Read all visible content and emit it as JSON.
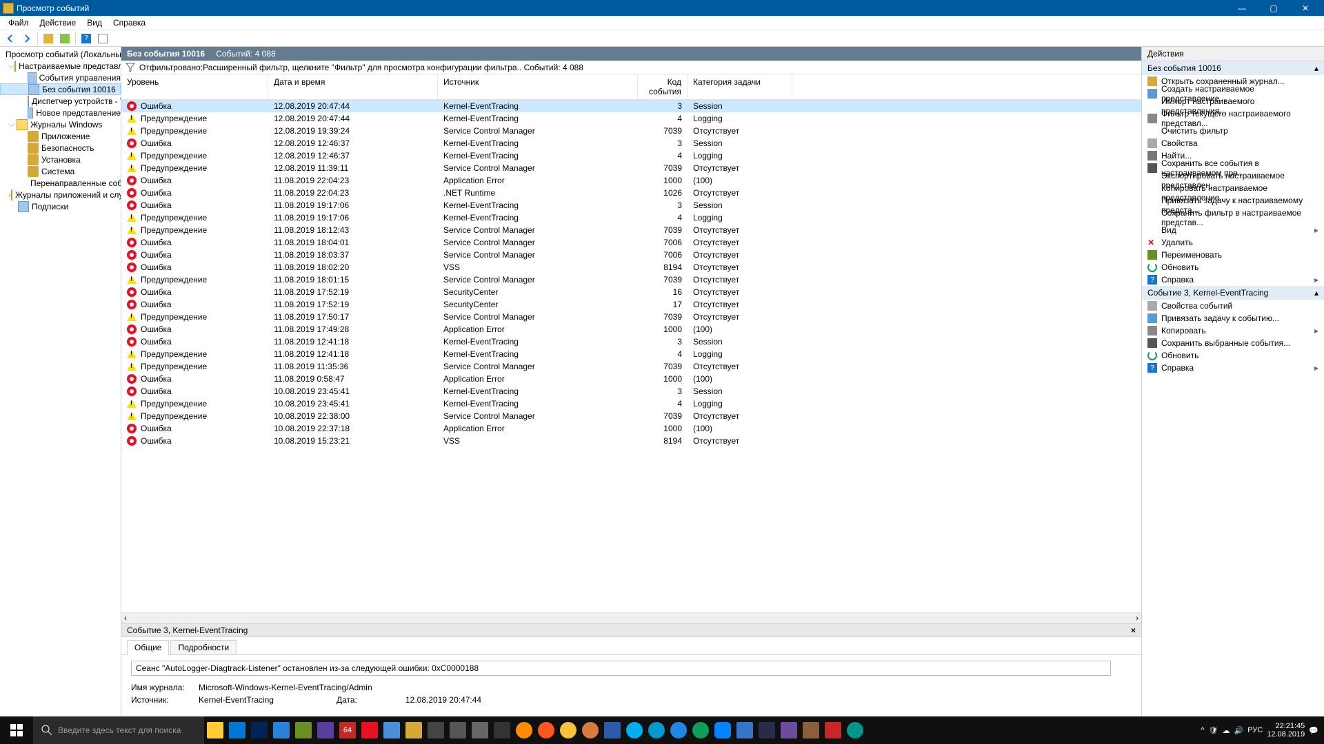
{
  "window": {
    "title": "Просмотр событий"
  },
  "menubar": {
    "items": [
      "Файл",
      "Действие",
      "Вид",
      "Справка"
    ]
  },
  "tree": {
    "root": "Просмотр событий (Локальный",
    "custom_views": {
      "label": "Настраиваемые представле",
      "children": [
        {
          "label": "События управления"
        },
        {
          "label": "Без события 10016",
          "selected": true
        },
        {
          "label": "Диспетчер устройств - V"
        },
        {
          "label": "Новое представление"
        }
      ]
    },
    "win_logs": {
      "label": "Журналы Windows",
      "children": [
        {
          "label": "Приложение"
        },
        {
          "label": "Безопасность"
        },
        {
          "label": "Установка"
        },
        {
          "label": "Система"
        },
        {
          "label": "Перенаправленные соб"
        }
      ]
    },
    "apps_logs": "Журналы приложений и слу",
    "subs": "Подписки"
  },
  "center": {
    "title": "Без события 10016",
    "count_label": "Событий: 4 088",
    "filter_note": "Отфильтровано:Расширенный фильтр, щелкните \"Фильтр\" для просмотра конфигурации фильтра.. Событий: 4 088"
  },
  "columns": {
    "level": "Уровень",
    "date": "Дата и время",
    "src": "Источник",
    "code": "Код события",
    "cat": "Категория задачи"
  },
  "events": [
    {
      "lvl": "err",
      "level": "Ошибка",
      "date": "12.08.2019 20:47:44",
      "src": "Kernel-EventTracing",
      "code": "3",
      "cat": "Session",
      "sel": true
    },
    {
      "lvl": "warn",
      "level": "Предупреждение",
      "date": "12.08.2019 20:47:44",
      "src": "Kernel-EventTracing",
      "code": "4",
      "cat": "Logging"
    },
    {
      "lvl": "warn",
      "level": "Предупреждение",
      "date": "12.08.2019 19:39:24",
      "src": "Service Control Manager",
      "code": "7039",
      "cat": "Отсутствует"
    },
    {
      "lvl": "err",
      "level": "Ошибка",
      "date": "12.08.2019 12:46:37",
      "src": "Kernel-EventTracing",
      "code": "3",
      "cat": "Session"
    },
    {
      "lvl": "warn",
      "level": "Предупреждение",
      "date": "12.08.2019 12:46:37",
      "src": "Kernel-EventTracing",
      "code": "4",
      "cat": "Logging"
    },
    {
      "lvl": "warn",
      "level": "Предупреждение",
      "date": "12.08.2019 11:39:11",
      "src": "Service Control Manager",
      "code": "7039",
      "cat": "Отсутствует"
    },
    {
      "lvl": "err",
      "level": "Ошибка",
      "date": "11.08.2019 22:04:23",
      "src": "Application Error",
      "code": "1000",
      "cat": "(100)"
    },
    {
      "lvl": "err",
      "level": "Ошибка",
      "date": "11.08.2019 22:04:23",
      "src": ".NET Runtime",
      "code": "1026",
      "cat": "Отсутствует"
    },
    {
      "lvl": "err",
      "level": "Ошибка",
      "date": "11.08.2019 19:17:06",
      "src": "Kernel-EventTracing",
      "code": "3",
      "cat": "Session"
    },
    {
      "lvl": "warn",
      "level": "Предупреждение",
      "date": "11.08.2019 19:17:06",
      "src": "Kernel-EventTracing",
      "code": "4",
      "cat": "Logging"
    },
    {
      "lvl": "warn",
      "level": "Предупреждение",
      "date": "11.08.2019 18:12:43",
      "src": "Service Control Manager",
      "code": "7039",
      "cat": "Отсутствует"
    },
    {
      "lvl": "err",
      "level": "Ошибка",
      "date": "11.08.2019 18:04:01",
      "src": "Service Control Manager",
      "code": "7006",
      "cat": "Отсутствует"
    },
    {
      "lvl": "err",
      "level": "Ошибка",
      "date": "11.08.2019 18:03:37",
      "src": "Service Control Manager",
      "code": "7006",
      "cat": "Отсутствует"
    },
    {
      "lvl": "err",
      "level": "Ошибка",
      "date": "11.08.2019 18:02:20",
      "src": "VSS",
      "code": "8194",
      "cat": "Отсутствует"
    },
    {
      "lvl": "warn",
      "level": "Предупреждение",
      "date": "11.08.2019 18:01:15",
      "src": "Service Control Manager",
      "code": "7039",
      "cat": "Отсутствует"
    },
    {
      "lvl": "err",
      "level": "Ошибка",
      "date": "11.08.2019 17:52:19",
      "src": "SecurityCenter",
      "code": "16",
      "cat": "Отсутствует"
    },
    {
      "lvl": "err",
      "level": "Ошибка",
      "date": "11.08.2019 17:52:19",
      "src": "SecurityCenter",
      "code": "17",
      "cat": "Отсутствует"
    },
    {
      "lvl": "warn",
      "level": "Предупреждение",
      "date": "11.08.2019 17:50:17",
      "src": "Service Control Manager",
      "code": "7039",
      "cat": "Отсутствует"
    },
    {
      "lvl": "err",
      "level": "Ошибка",
      "date": "11.08.2019 17:49:28",
      "src": "Application Error",
      "code": "1000",
      "cat": "(100)"
    },
    {
      "lvl": "err",
      "level": "Ошибка",
      "date": "11.08.2019 12:41:18",
      "src": "Kernel-EventTracing",
      "code": "3",
      "cat": "Session"
    },
    {
      "lvl": "warn",
      "level": "Предупреждение",
      "date": "11.08.2019 12:41:18",
      "src": "Kernel-EventTracing",
      "code": "4",
      "cat": "Logging"
    },
    {
      "lvl": "warn",
      "level": "Предупреждение",
      "date": "11.08.2019 11:35:36",
      "src": "Service Control Manager",
      "code": "7039",
      "cat": "Отсутствует"
    },
    {
      "lvl": "err",
      "level": "Ошибка",
      "date": "11.08.2019 0:58:47",
      "src": "Application Error",
      "code": "1000",
      "cat": "(100)"
    },
    {
      "lvl": "err",
      "level": "Ошибка",
      "date": "10.08.2019 23:45:41",
      "src": "Kernel-EventTracing",
      "code": "3",
      "cat": "Session"
    },
    {
      "lvl": "warn",
      "level": "Предупреждение",
      "date": "10.08.2019 23:45:41",
      "src": "Kernel-EventTracing",
      "code": "4",
      "cat": "Logging"
    },
    {
      "lvl": "warn",
      "level": "Предупреждение",
      "date": "10.08.2019 22:38:00",
      "src": "Service Control Manager",
      "code": "7039",
      "cat": "Отсутствует"
    },
    {
      "lvl": "err",
      "level": "Ошибка",
      "date": "10.08.2019 22:37:18",
      "src": "Application Error",
      "code": "1000",
      "cat": "(100)"
    },
    {
      "lvl": "err",
      "level": "Ошибка",
      "date": "10.08.2019 15:23:21",
      "src": "VSS",
      "code": "8194",
      "cat": "Отсутствует"
    }
  ],
  "detail": {
    "header": "Событие 3, Kernel-EventTracing",
    "tabs": {
      "general": "Общие",
      "details": "Подробности"
    },
    "message": "Сеанс \"AutoLogger-Diagtrack-Listener\" остановлен из-за следующей ошибки: 0xC0000188",
    "log_label": "Имя журнала:",
    "log_value": "Microsoft-Windows-Kernel-EventTracing/Admin",
    "src_label": "Источник:",
    "src_value": "Kernel-EventTracing",
    "date_label": "Дата:",
    "date_value": "12.08.2019 20:47:44"
  },
  "actions": {
    "title": "Действия",
    "group1": {
      "header": "Без события 10016",
      "items": [
        {
          "icon": "open",
          "label": "Открыть сохраненный журнал..."
        },
        {
          "icon": "create",
          "label": "Создать настраиваемое представление..."
        },
        {
          "icon": "",
          "label": "Импорт настраиваемого представления..."
        },
        {
          "icon": "filter",
          "label": "Фильтр текущего настраиваемого представл..."
        },
        {
          "icon": "",
          "label": "Очистить фильтр"
        },
        {
          "icon": "props",
          "label": "Свойства"
        },
        {
          "icon": "find",
          "label": "Найти..."
        },
        {
          "icon": "save",
          "label": "Сохранить все события в настраиваемом пре..."
        },
        {
          "icon": "",
          "label": "Экспортировать настраиваемое представлен..."
        },
        {
          "icon": "",
          "label": "Копировать настраиваемое представление..."
        },
        {
          "icon": "",
          "label": "Привязать задачу к настраиваемому предста..."
        },
        {
          "icon": "",
          "label": "Сохранить фильтр в настраиваемое представ..."
        },
        {
          "icon": "",
          "label": "Вид",
          "arrow": true
        },
        {
          "icon": "del",
          "label": "Удалить"
        },
        {
          "icon": "rename",
          "label": "Переименовать"
        },
        {
          "icon": "refresh",
          "label": "Обновить"
        },
        {
          "icon": "help",
          "label": "Справка",
          "arrow": true
        }
      ]
    },
    "group2": {
      "header": "Событие 3, Kernel-EventTracing",
      "items": [
        {
          "icon": "props",
          "label": "Свойства событий"
        },
        {
          "icon": "task",
          "label": "Привязать задачу к событию..."
        },
        {
          "icon": "copy",
          "label": "Копировать",
          "arrow": true
        },
        {
          "icon": "save",
          "label": "Сохранить выбранные события..."
        },
        {
          "icon": "refresh",
          "label": "Обновить"
        },
        {
          "icon": "help",
          "label": "Справка",
          "arrow": true
        }
      ]
    }
  },
  "taskbar": {
    "search_placeholder": "Введите здесь текст для поиска",
    "lang": "РУС",
    "time": "22:21:45",
    "date": "12.08.2019"
  }
}
